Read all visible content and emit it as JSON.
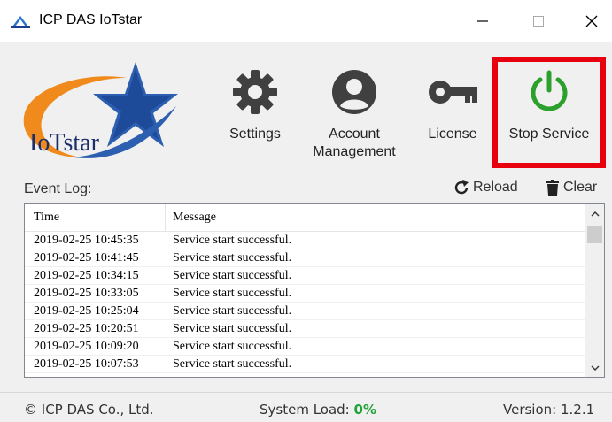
{
  "window": {
    "title": "ICP DAS IoTstar",
    "minimize_glyph": "—",
    "maximize_glyph": "☐",
    "close_glyph": "✕"
  },
  "logo": {
    "text": "IoTstar"
  },
  "toolbar": {
    "settings_label": "Settings",
    "account_label_1": "Account",
    "account_label_2": "Management",
    "license_label": "License",
    "stop_label": "Stop Service",
    "stop_color": "#2ca02c",
    "highlight_color": "#e8000e"
  },
  "eventlog": {
    "label": "Event Log:",
    "reload_label": "Reload",
    "clear_label": "Clear",
    "columns": [
      "Time",
      "Message"
    ],
    "rows": [
      {
        "time": "2019-02-25 10:45:35",
        "message": "Service start successful."
      },
      {
        "time": "2019-02-25 10:41:45",
        "message": "Service start successful."
      },
      {
        "time": "2019-02-25 10:34:15",
        "message": "Service start successful."
      },
      {
        "time": "2019-02-25 10:33:05",
        "message": "Service start successful."
      },
      {
        "time": "2019-02-25 10:25:04",
        "message": "Service start successful."
      },
      {
        "time": "2019-02-25 10:20:51",
        "message": "Service start successful."
      },
      {
        "time": "2019-02-25 10:09:20",
        "message": "Service start successful."
      },
      {
        "time": "2019-02-25 10:07:53",
        "message": "Service start successful."
      }
    ]
  },
  "status": {
    "copyright": "© ICP DAS Co., Ltd.",
    "load_label": "System Load: ",
    "load_value": "0%",
    "load_color": "#22a33a",
    "version": "Version: 1.2.1"
  }
}
